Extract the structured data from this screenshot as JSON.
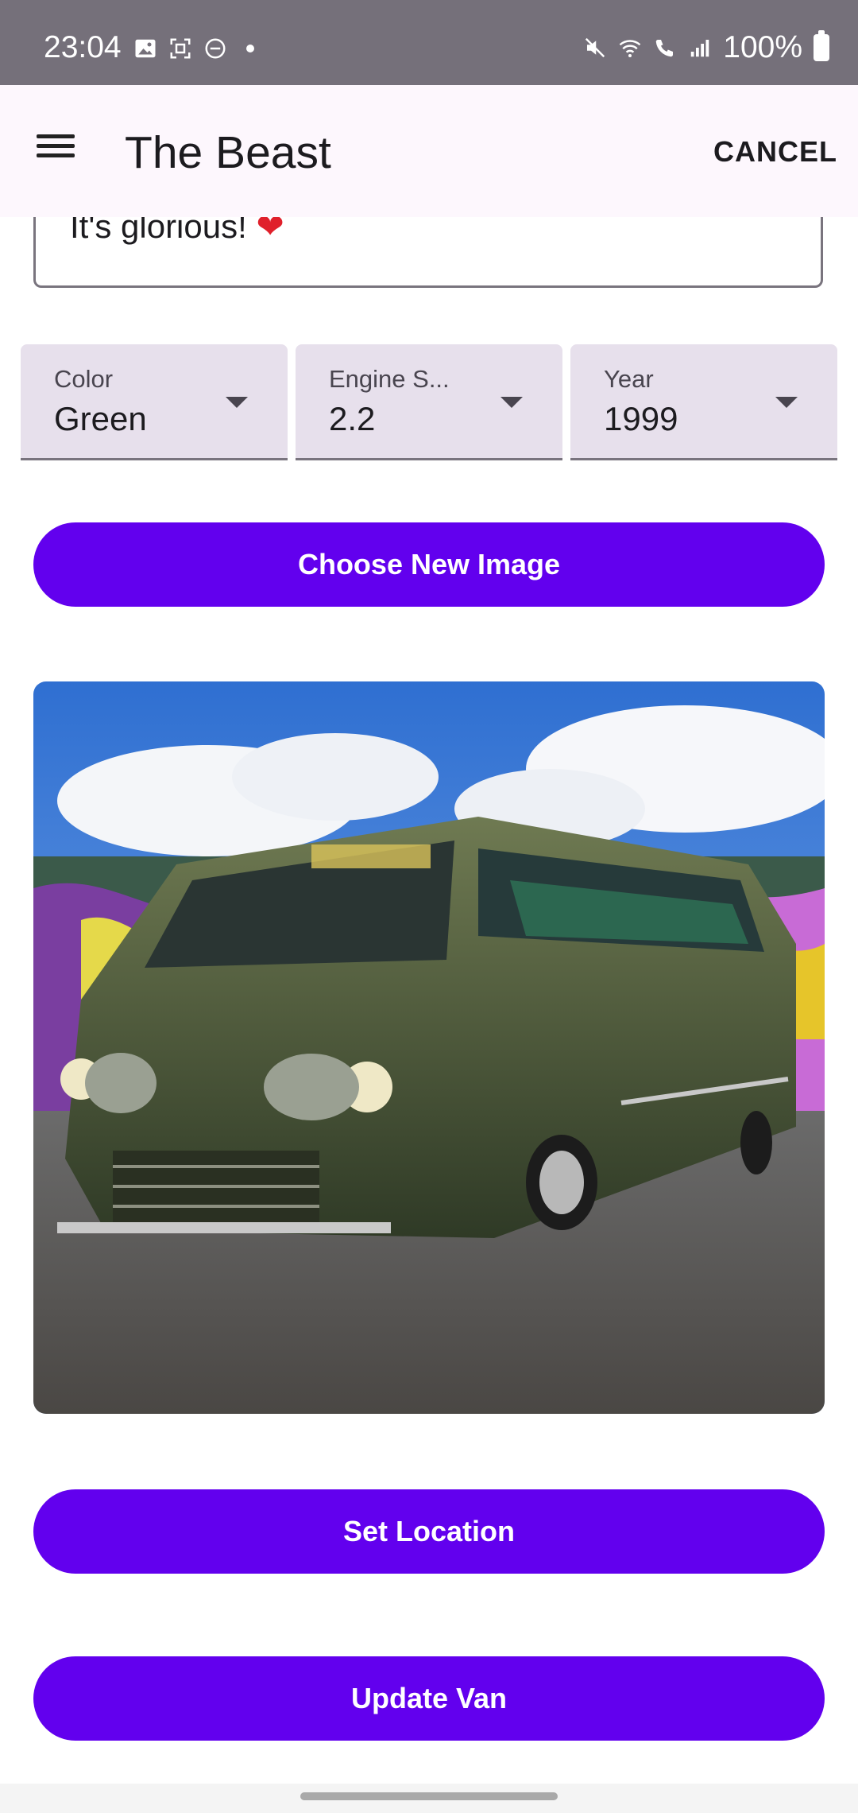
{
  "status_bar": {
    "time": "23:04",
    "battery_text": "100%",
    "icons_left": [
      "image-icon",
      "screenshot-icon",
      "dnd-icon",
      "dot-icon"
    ],
    "icons_right": [
      "mute-icon",
      "wifi-icon",
      "wifi-call-icon",
      "signal-icon",
      "battery-icon"
    ]
  },
  "app_bar": {
    "title": "The Beast",
    "cancel_label": "CANCEL"
  },
  "description_field": {
    "value": "It's glorious! ",
    "emoji": "❤"
  },
  "dropdowns": [
    {
      "label": "Color",
      "value": "Green"
    },
    {
      "label": "Engine S...",
      "value": "2.2"
    },
    {
      "label": "Year",
      "value": "1999"
    }
  ],
  "buttons": {
    "choose_image": "Choose New Image",
    "set_location": "Set Location",
    "update_van": "Update Van"
  },
  "colors": {
    "primary": "#6200ee",
    "status_bar": "#75707a",
    "app_bar": "#fdf7fd",
    "dropdown_bg": "#e7e0ec"
  }
}
